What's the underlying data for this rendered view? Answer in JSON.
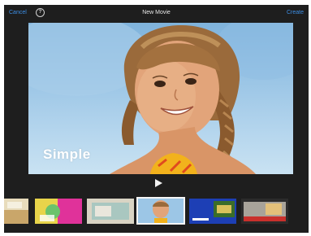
{
  "topbar": {
    "cancel_label": "Cancel",
    "help_label": "?",
    "title": "New Movie",
    "create_label": "Create"
  },
  "preview": {
    "theme_label": "Simple"
  },
  "colors": {
    "accent": "#3d8fe6",
    "background": "#1e1e1e"
  },
  "themes": [
    {
      "name": "theme-1",
      "selected": false
    },
    {
      "name": "theme-2",
      "selected": false
    },
    {
      "name": "theme-3",
      "selected": false
    },
    {
      "name": "theme-simple",
      "selected": true
    },
    {
      "name": "theme-5",
      "selected": false
    },
    {
      "name": "theme-6",
      "selected": false
    }
  ]
}
